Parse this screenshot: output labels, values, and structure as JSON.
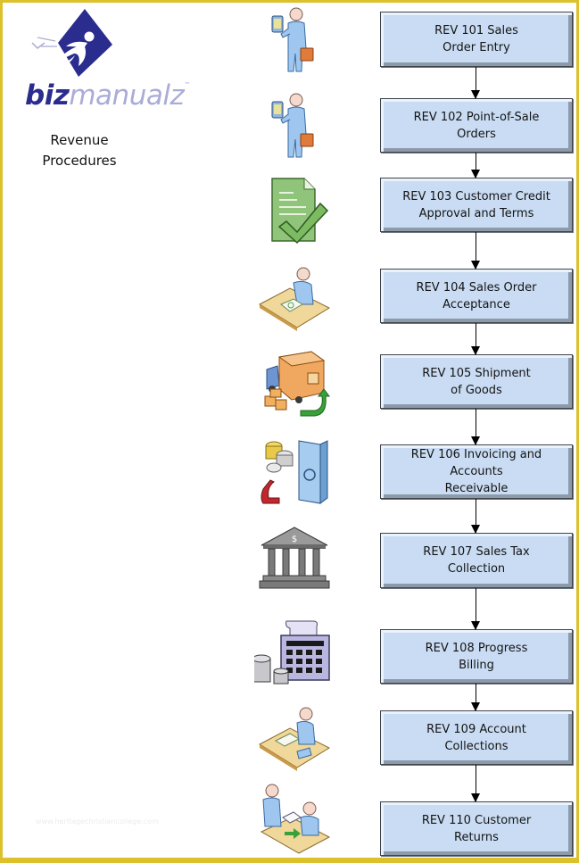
{
  "logo": {
    "word_bold": "biz",
    "word_light": "manualz",
    "trademark": "™",
    "colors": {
      "primary": "#2a2c8e",
      "secondary": "#a9acd6"
    }
  },
  "title": "Revenue\nProcedures",
  "watermark": "www.heritagechristiancollege.com",
  "colors": {
    "frame": "#dcc12c",
    "box_fill": "#c9dcf3",
    "box_border": "#3f454c",
    "arrow": "#000000"
  },
  "steps": [
    {
      "label": "REV 101 Sales\nOrder Entry",
      "icon": "salesperson-with-device-icon"
    },
    {
      "label": "REV 102 Point-of-Sale\nOrders",
      "icon": "salesperson-with-device-icon"
    },
    {
      "label": "REV 103 Customer Credit\nApproval and Terms",
      "icon": "approved-document-icon"
    },
    {
      "label": "REV 104 Sales Order Acceptance",
      "icon": "person-at-desk-signing-icon"
    },
    {
      "label": "REV 105 Shipment\nof Goods",
      "icon": "delivery-truck-icon"
    },
    {
      "label": "REV 106 Invoicing and Accounts\nReceivable",
      "icon": "coins-and-safe-icon"
    },
    {
      "label": "REV 107 Sales Tax\nCollection",
      "icon": "government-building-icon"
    },
    {
      "label": "REV 108 Progress\nBilling",
      "icon": "calculator-and-coins-icon"
    },
    {
      "label": "REV 109 Account\nCollections",
      "icon": "person-at-desk-phone-icon"
    },
    {
      "label": "REV 110 Customer\nReturns",
      "icon": "customer-return-exchange-icon"
    }
  ]
}
